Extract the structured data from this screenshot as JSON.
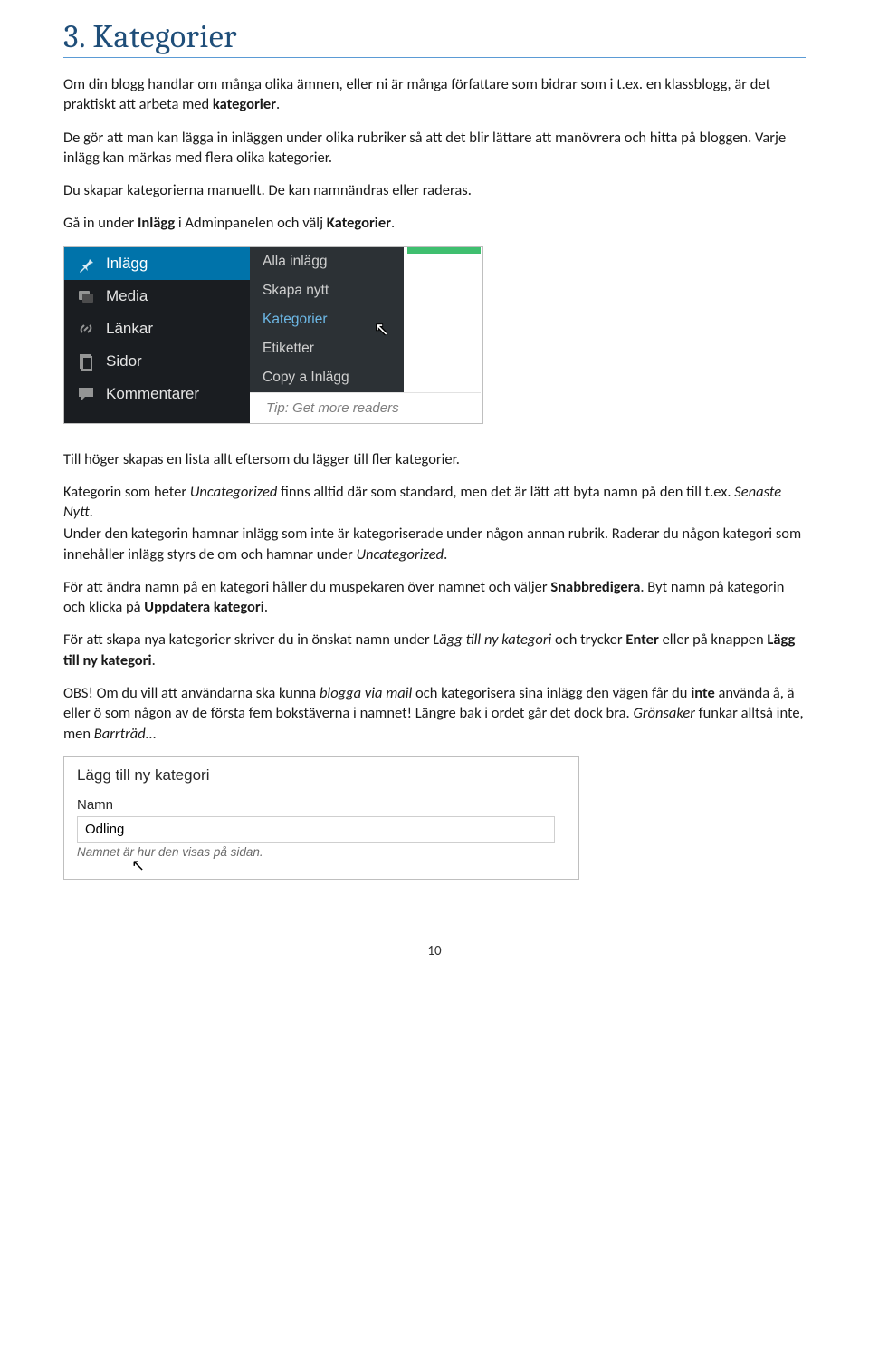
{
  "heading": "3.      Kategorier",
  "p1_a": "Om din blogg handlar om många olika ämnen, eller ni är många författare som bidrar som i t.ex. en klassblogg, är det praktiskt att arbeta med ",
  "p1_b": "kategorier",
  "p1_c": ".",
  "p2": "De gör att man kan lägga in inläggen under olika rubriker så att det blir lättare att manövrera och hitta på bloggen. Varje inlägg kan märkas med flera olika kategorier.",
  "p3": "Du skapar kategorierna manuellt. De kan namnändras eller raderas.",
  "p4_a": "Gå in under ",
  "p4_b": "Inlägg",
  "p4_c": " i Adminpanelen och välj ",
  "p4_d": "Kategorier",
  "p4_e": ".",
  "wp": {
    "items": [
      {
        "label": "Inlägg",
        "icon": "pin"
      },
      {
        "label": "Media",
        "icon": "media"
      },
      {
        "label": "Länkar",
        "icon": "link"
      },
      {
        "label": "Sidor",
        "icon": "page"
      },
      {
        "label": "Kommentarer",
        "icon": "comment"
      }
    ],
    "sub": [
      "Alla inlägg",
      "Skapa nytt",
      "Kategorier",
      "Etiketter",
      "Copy a Inlägg"
    ],
    "tip": "Tip: Get more readers"
  },
  "p5": "Till höger skapas en lista allt eftersom du lägger till fler kategorier.",
  "p6_a": "Kategorin som heter ",
  "p6_b": "Uncategorized",
  "p6_c": " finns alltid där som standard, men det är lätt att byta namn på den till t.ex. ",
  "p6_d": "Senaste Nytt",
  "p6_e": ".",
  "p7_a": "Under den kategorin hamnar inlägg som inte är kategoriserade under någon annan rubrik. Raderar du någon kategori som innehåller inlägg styrs de om och hamnar under ",
  "p7_b": "Uncategorized",
  "p7_c": ".",
  "p8_a": "För att ändra namn på en kategori håller du muspekaren över namnet och väljer ",
  "p8_b": "Snabbredigera",
  "p8_c": ". Byt namn på kategorin och klicka på ",
  "p8_d": "Uppdatera kategori",
  "p8_e": ".",
  "p9_a": "För att skapa nya kategorier skriver du in önskat namn under ",
  "p9_b": "Lägg till ny kategori",
  "p9_c": " och trycker ",
  "p9_d": "Enter",
  "p9_e": " eller på knappen ",
  "p9_f": "Lägg till ny kategori",
  "p9_g": ".",
  "p10_a": "OBS! Om du vill att användarna ska kunna ",
  "p10_b": "blogga via mail",
  "p10_c": " och kategorisera sina inlägg den vägen får du ",
  "p10_d": "inte",
  "p10_e": " använda å, ä eller ö som någon av de första fem bokstäverna i namnet! Längre bak i ordet går det dock bra. ",
  "p10_f": "Grönsaker",
  "p10_g": " funkar alltså inte, men ",
  "p10_h": "Barrträd",
  "p10_i": "…",
  "form": {
    "title": "Lägg till ny kategori",
    "name_label": "Namn",
    "name_value": "Odling",
    "help": "Namnet är hur den visas på sidan."
  },
  "page_number": "10"
}
